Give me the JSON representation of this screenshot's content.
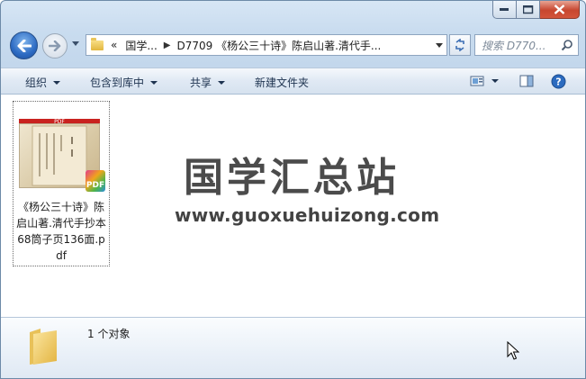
{
  "address_bar": {
    "overflow": "«",
    "crumbs": [
      "国学...",
      "D7709 《杨公三十诗》陈启山著.清代手..."
    ]
  },
  "search": {
    "placeholder": "搜索 D770..."
  },
  "toolbar": {
    "organize": "组织",
    "include_in_library": "包含到库中",
    "share": "共享",
    "new_folder": "新建文件夹"
  },
  "files": [
    {
      "name": "《杨公三十诗》陈启山著.清代手抄本68筒子页136面.pdf",
      "thumb_banner": "PDF",
      "badge": "PDF"
    }
  ],
  "watermark": {
    "cn": "国学汇总站",
    "url": "www.guoxuehuizong.com"
  },
  "details": {
    "status": "1 个对象"
  },
  "colors": {
    "accent": "#2d6bc3",
    "close": "#c7462f",
    "toolbar_text": "#1e3350"
  },
  "icons": [
    "back-arrow-icon",
    "forward-arrow-icon",
    "folder-icon",
    "refresh-icon",
    "search-icon",
    "views-icon",
    "preview-pane-icon",
    "help-icon",
    "pdf-icon",
    "cursor-icon"
  ]
}
